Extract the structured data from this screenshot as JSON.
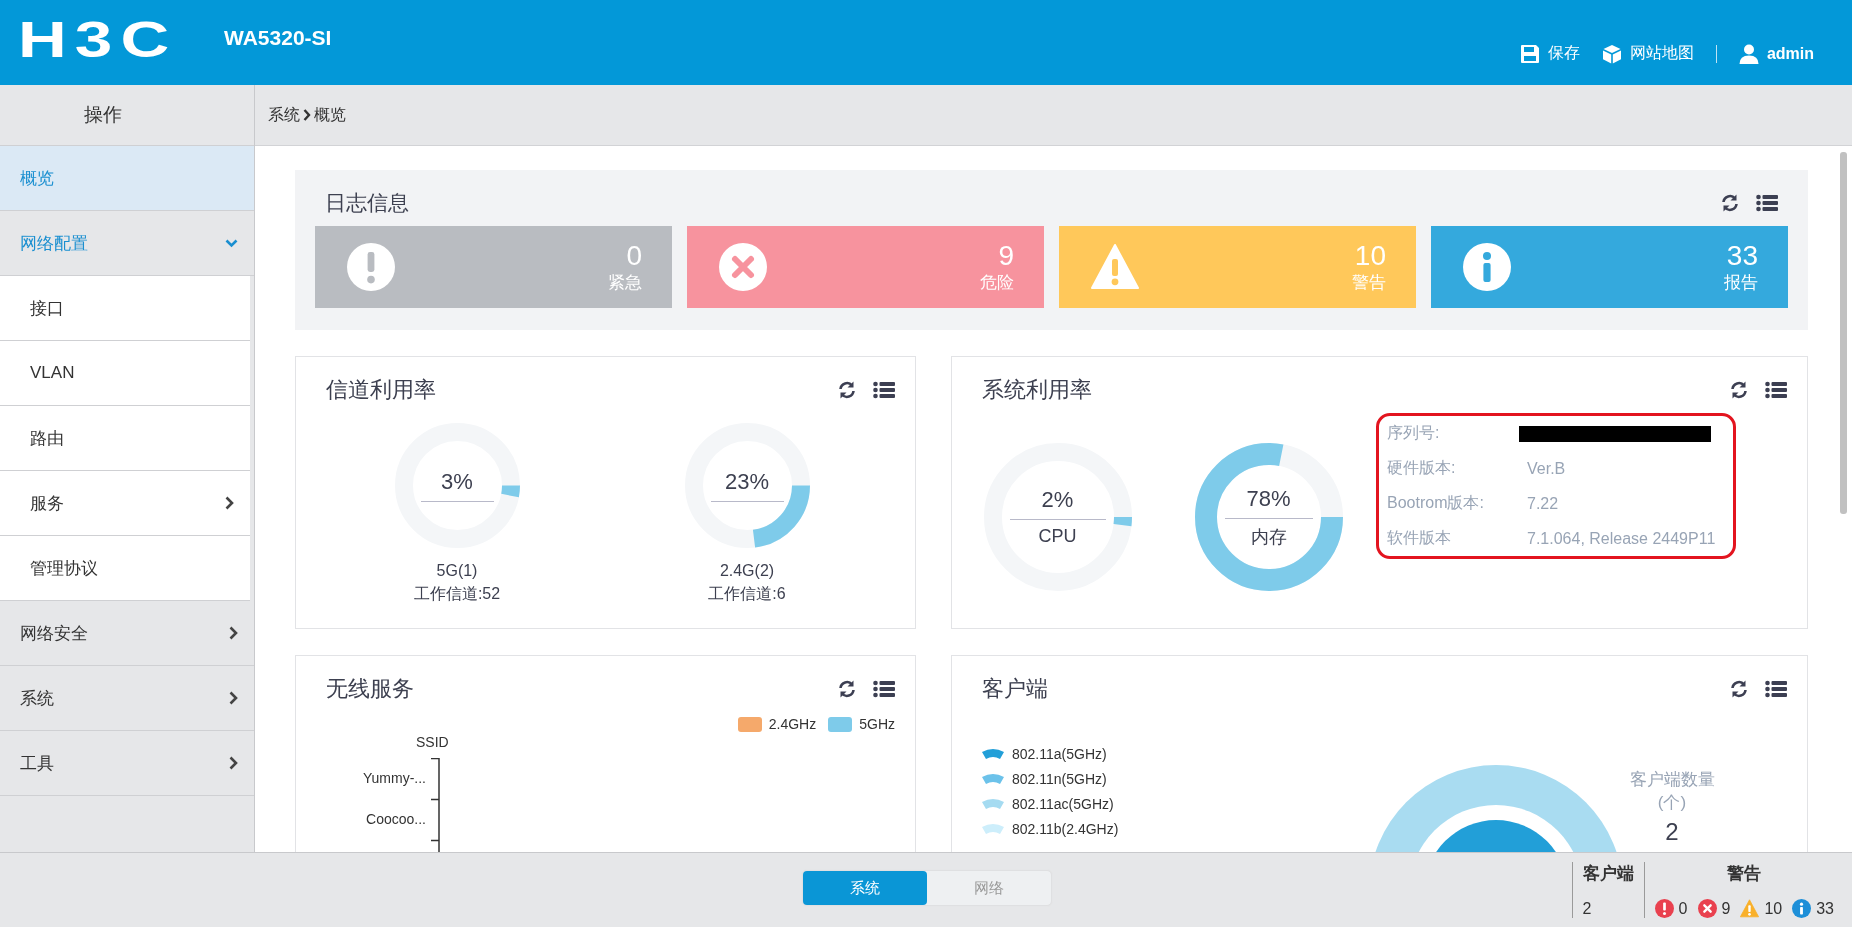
{
  "header": {
    "logo": "H3C",
    "model": "WA5320-SI",
    "actions": [
      {
        "kind": "save",
        "label": "保存"
      },
      {
        "kind": "sitemap",
        "label": "网站地图"
      },
      {
        "kind": "user",
        "label": "admin"
      }
    ]
  },
  "sidebar": {
    "title": "操作",
    "items": [
      {
        "label": "概览",
        "selected": true
      },
      {
        "label": "网络配置",
        "selected": false,
        "expanded": true,
        "children": [
          {
            "label": "接口",
            "selected": false
          },
          {
            "label": "VLAN",
            "selected": false
          },
          {
            "label": "路由",
            "selected": false
          },
          {
            "label": "服务",
            "selected": false,
            "expanded": false
          },
          {
            "label": "管理协议",
            "selected": false
          }
        ]
      },
      {
        "label": "网络安全",
        "selected": false,
        "expanded": false
      },
      {
        "label": "系统",
        "selected": false,
        "expanded": false
      },
      {
        "label": "工具",
        "selected": false,
        "expanded": false
      }
    ]
  },
  "breadcrumb": [
    "系统",
    "概览"
  ],
  "log_info": {
    "title": "日志信息",
    "cards": [
      {
        "kind": "emergency",
        "count": "0",
        "label": "紧急"
      },
      {
        "kind": "danger",
        "count": "9",
        "label": "危险"
      },
      {
        "kind": "warning",
        "count": "10",
        "label": "警告"
      },
      {
        "kind": "info",
        "count": "33",
        "label": "报告"
      }
    ]
  },
  "channel_usage": {
    "title": "信道利用率",
    "gauges": [
      {
        "value": "3%",
        "level": 0.03,
        "band": "5G(1)",
        "channel": "工作信道:52"
      },
      {
        "value": "23%",
        "level": 0.23,
        "band": "2.4G(2)",
        "channel": "工作信道:6"
      }
    ]
  },
  "system_usage": {
    "title": "系统利用率",
    "gauges": [
      {
        "value": "2%",
        "level": 0.02,
        "label": "CPU"
      },
      {
        "value": "78%",
        "level": 0.78,
        "label": "内存"
      }
    ],
    "info": [
      {
        "label": "序列号:",
        "redacted": true
      },
      {
        "label": "硬件版本:",
        "value": "Ver.B"
      },
      {
        "label": "Bootrom版本:",
        "value": "7.22"
      },
      {
        "label": "软件版本",
        "value": "7.1.064, Release 2449P11"
      }
    ]
  },
  "wireless_service": {
    "title": "无线服务",
    "legend": [
      {
        "label": "2.4GHz",
        "color": "#f5a96b"
      },
      {
        "label": "5GHz",
        "color": "#7ecbea"
      }
    ],
    "axis_title": "SSID",
    "categories": [
      "Yummy-...",
      "Coocoo..."
    ]
  },
  "clients": {
    "title": "客户端",
    "legend": [
      {
        "label": "802.11a(5GHz)",
        "color": "#229fd8"
      },
      {
        "label": "802.11n(5GHz)",
        "color": "#6cc2ea"
      },
      {
        "label": "802.11ac(5GHz)",
        "color": "#a5dbf1"
      },
      {
        "label": "802.11b(2.4GHz)",
        "color": "#cdeefb"
      }
    ],
    "count_label": "客户端数量",
    "count_unit": "(个)",
    "count": "2"
  },
  "bottom_bar": {
    "tabs": [
      {
        "label": "系统",
        "selected": true
      },
      {
        "label": "网络",
        "selected": false
      }
    ],
    "clients": {
      "label": "客户端",
      "value": "2"
    },
    "alerts": {
      "label": "警告",
      "items": [
        {
          "kind": "emergency",
          "count": "0"
        },
        {
          "kind": "danger",
          "count": "9"
        },
        {
          "kind": "warning",
          "count": "10"
        },
        {
          "kind": "info",
          "count": "33"
        }
      ]
    }
  }
}
